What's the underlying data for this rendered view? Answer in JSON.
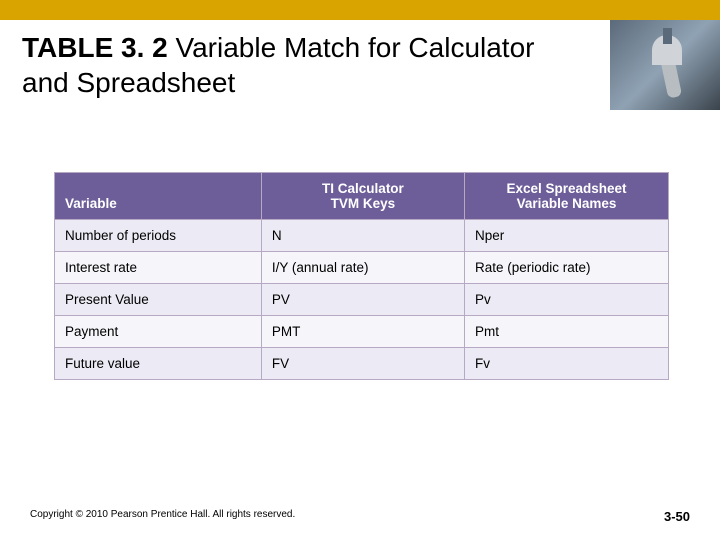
{
  "title": {
    "bold": "TABLE 3. 2",
    "rest": "  Variable Match for Calculator and Spreadsheet"
  },
  "table": {
    "headers": [
      "Variable",
      "TI Calculator\nTVM Keys",
      "Excel Spreadsheet\nVariable Names"
    ],
    "rows": [
      {
        "variable": "Number of periods",
        "ti": "N",
        "excel": "Nper"
      },
      {
        "variable": "Interest rate",
        "ti": "I/Y (annual rate)",
        "excel": "Rate (periodic rate)"
      },
      {
        "variable": "Present Value",
        "ti": "PV",
        "excel": "Pv"
      },
      {
        "variable": "Payment",
        "ti": "PMT",
        "excel": "Pmt"
      },
      {
        "variable": "Future value",
        "ti": "FV",
        "excel": "Fv"
      }
    ]
  },
  "copyright": "Copyright © 2010 Pearson Prentice Hall. All rights reserved.",
  "page_number": "3-50",
  "chart_data": {
    "type": "table",
    "title": "TABLE 3.2 Variable Match for Calculator and Spreadsheet",
    "columns": [
      "Variable",
      "TI Calculator TVM Keys",
      "Excel Spreadsheet Variable Names"
    ],
    "rows": [
      [
        "Number of periods",
        "N",
        "Nper"
      ],
      [
        "Interest rate",
        "I/Y (annual rate)",
        "Rate (periodic rate)"
      ],
      [
        "Present Value",
        "PV",
        "Pv"
      ],
      [
        "Payment",
        "PMT",
        "Pmt"
      ],
      [
        "Future value",
        "FV",
        "Fv"
      ]
    ]
  }
}
